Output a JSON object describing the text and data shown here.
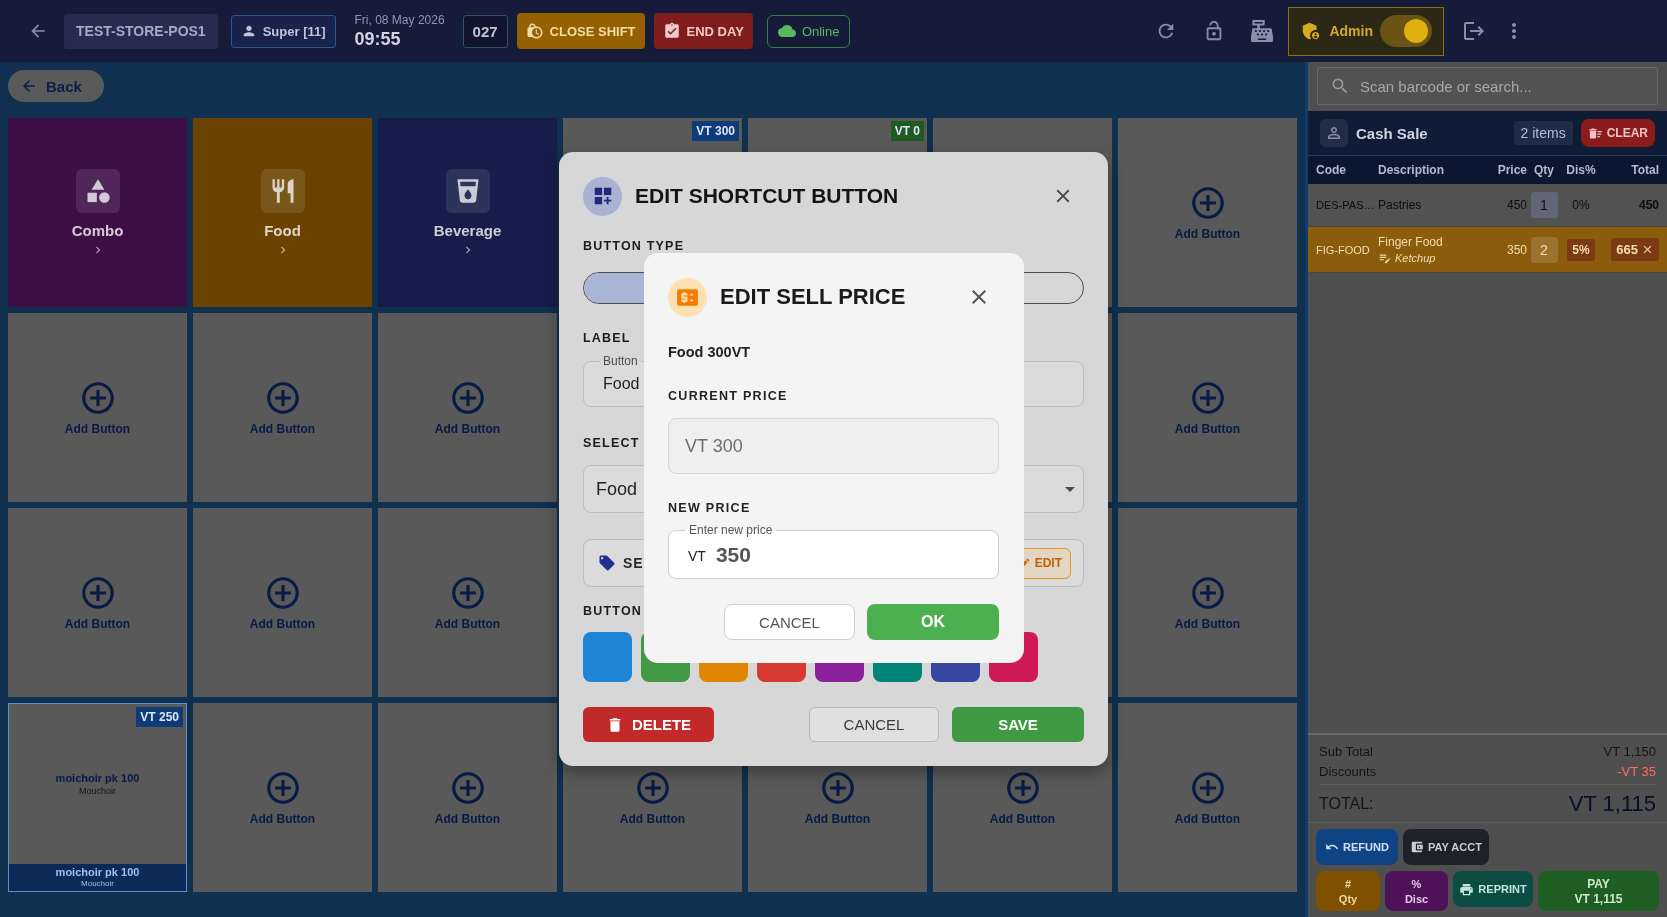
{
  "top_bar": {
    "store": "TEST-STORE-POS1",
    "user": "Super [11]",
    "date": "Fri, 08 May 2026",
    "time": "09:55",
    "counter": "027",
    "actions": [
      {
        "kind": "close_shift",
        "label": "CLOSE SHIFT"
      },
      {
        "kind": "end_day",
        "label": "END DAY"
      }
    ],
    "status": {
      "label": "Online",
      "online": true
    },
    "role": {
      "label": "Admin",
      "on": true
    }
  },
  "back_button": "Back",
  "tiles": [
    {
      "kind": "category",
      "label": "Combo",
      "color": "#3e0f47"
    },
    {
      "kind": "category",
      "label": "Food",
      "color": "#6a4300"
    },
    {
      "kind": "category",
      "label": "Beverage",
      "color": "#161d4a"
    },
    {
      "kind": "product",
      "price": "VT 300",
      "color": "#0d3c78"
    },
    {
      "kind": "product",
      "price": "VT 0",
      "color": "#1f5a22"
    },
    {
      "kind": "blank"
    },
    {
      "kind": "add",
      "label": "Add Button"
    },
    {
      "kind": "add",
      "label": "Add Button"
    },
    {
      "kind": "add",
      "label": "Add Button"
    },
    {
      "kind": "add",
      "label": "Add Button"
    },
    {
      "kind": "blank"
    },
    {
      "kind": "blank"
    },
    {
      "kind": "blank"
    },
    {
      "kind": "add",
      "label": "Add Button"
    },
    {
      "kind": "add",
      "label": "Add Button"
    },
    {
      "kind": "add",
      "label": "Add Button"
    },
    {
      "kind": "add",
      "label": "Add Button"
    },
    {
      "kind": "blank"
    },
    {
      "kind": "blank"
    },
    {
      "kind": "blank"
    },
    {
      "kind": "add",
      "label": "Add Button"
    },
    {
      "kind": "product",
      "price": "VT 250",
      "color": "#0d3c78",
      "label": "moichoir pk 100",
      "sublabel": "Mouchoir",
      "footer": {
        "label": "moichoir pk 100",
        "sublabel": "Mouchoir"
      }
    },
    {
      "kind": "add",
      "label": "Add Button"
    },
    {
      "kind": "add",
      "label": "Add Button"
    },
    {
      "kind": "add",
      "label": "Add Button"
    },
    {
      "kind": "add",
      "label": "Add Button"
    },
    {
      "kind": "add",
      "label": "Add Button"
    },
    {
      "kind": "add",
      "label": "Add Button"
    }
  ],
  "shortcut_dialog": {
    "title": "EDIT SHORTCUT BUTTON",
    "type_label": "BUTTON TYPE",
    "label_label": "LABEL",
    "label_field": {
      "legend": "Button",
      "value": "Food"
    },
    "select_label": "SELECT",
    "select_value": "Food",
    "price_label": "SE",
    "edit_button": "EDIT",
    "color_label": "BUTTON",
    "colors": [
      {
        "color": "#1d84d6"
      },
      {
        "color": "#439a46"
      },
      {
        "color": "#e08600"
      },
      {
        "color": "#d73b30"
      },
      {
        "color": "#89229b"
      },
      {
        "color": "#008478"
      },
      {
        "color": "#37479f"
      },
      {
        "color": "#cd1a57"
      }
    ],
    "buttons": [
      {
        "kind": "delete",
        "label": "DELETE"
      },
      {
        "kind": "cancel",
        "label": "CANCEL"
      },
      {
        "kind": "save",
        "label": "SAVE"
      }
    ]
  },
  "price_dialog": {
    "title": "EDIT SELL PRICE",
    "item": "Food 300VT",
    "current_label": "CURRENT PRICE",
    "current_value": "VT 300",
    "new_label": "NEW PRICE",
    "new_field": {
      "legend": "Enter new price",
      "prefix": "VT",
      "value": "350"
    },
    "buttons": [
      {
        "kind": "cancel",
        "label": "CANCEL"
      },
      {
        "kind": "ok",
        "label": "OK"
      }
    ]
  },
  "cart": {
    "search_placeholder": "Scan barcode or search...",
    "customer": "Cash Sale",
    "count": "2 items",
    "clear": "CLEAR",
    "columns": [
      "Code",
      "Description",
      "Price",
      "Qty",
      "Dis%",
      "Total"
    ],
    "rows": [
      {
        "code": "DES-PAS…",
        "description": "Pastries",
        "price": "450",
        "qty": "1",
        "discount": "0%",
        "total": "450",
        "selected": false
      },
      {
        "code": "FIG-FOOD",
        "description": "Finger Food",
        "note": "Ketchup",
        "price": "350",
        "qty": "2",
        "discount": "5%",
        "total": "665",
        "selected": true
      }
    ],
    "summary": [
      {
        "kind": "amount",
        "label": "Sub Total",
        "value": "VT 1,150"
      },
      {
        "kind": "discount",
        "label": "Discounts",
        "value": "-VT 35"
      }
    ],
    "total": {
      "label": "TOTAL:",
      "value": "VT 1,115"
    },
    "action_rows": [
      [
        {
          "kind": "refund",
          "label": "REFUND"
        },
        {
          "kind": "pay_account",
          "label": "PAY ACCT"
        }
      ],
      [
        {
          "kind": "qty",
          "lines": [
            "#",
            "Qty"
          ]
        },
        {
          "kind": "disc",
          "lines": [
            "%",
            "Disc"
          ]
        },
        {
          "kind": "reprint",
          "label": "REPRINT"
        },
        {
          "kind": "pay",
          "lines": [
            "PAY",
            "VT 1,115"
          ]
        }
      ]
    ]
  }
}
